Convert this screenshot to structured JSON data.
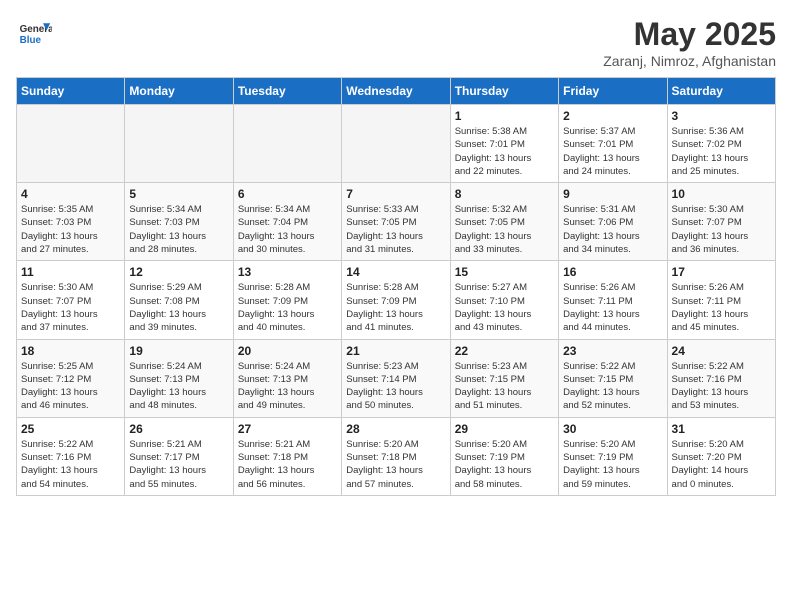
{
  "header": {
    "logo_line1": "General",
    "logo_line2": "Blue",
    "month": "May 2025",
    "location": "Zaranj, Nimroz, Afghanistan"
  },
  "weekdays": [
    "Sunday",
    "Monday",
    "Tuesday",
    "Wednesday",
    "Thursday",
    "Friday",
    "Saturday"
  ],
  "weeks": [
    [
      {
        "day": "",
        "info": ""
      },
      {
        "day": "",
        "info": ""
      },
      {
        "day": "",
        "info": ""
      },
      {
        "day": "",
        "info": ""
      },
      {
        "day": "1",
        "info": "Sunrise: 5:38 AM\nSunset: 7:01 PM\nDaylight: 13 hours\nand 22 minutes."
      },
      {
        "day": "2",
        "info": "Sunrise: 5:37 AM\nSunset: 7:01 PM\nDaylight: 13 hours\nand 24 minutes."
      },
      {
        "day": "3",
        "info": "Sunrise: 5:36 AM\nSunset: 7:02 PM\nDaylight: 13 hours\nand 25 minutes."
      }
    ],
    [
      {
        "day": "4",
        "info": "Sunrise: 5:35 AM\nSunset: 7:03 PM\nDaylight: 13 hours\nand 27 minutes."
      },
      {
        "day": "5",
        "info": "Sunrise: 5:34 AM\nSunset: 7:03 PM\nDaylight: 13 hours\nand 28 minutes."
      },
      {
        "day": "6",
        "info": "Sunrise: 5:34 AM\nSunset: 7:04 PM\nDaylight: 13 hours\nand 30 minutes."
      },
      {
        "day": "7",
        "info": "Sunrise: 5:33 AM\nSunset: 7:05 PM\nDaylight: 13 hours\nand 31 minutes."
      },
      {
        "day": "8",
        "info": "Sunrise: 5:32 AM\nSunset: 7:05 PM\nDaylight: 13 hours\nand 33 minutes."
      },
      {
        "day": "9",
        "info": "Sunrise: 5:31 AM\nSunset: 7:06 PM\nDaylight: 13 hours\nand 34 minutes."
      },
      {
        "day": "10",
        "info": "Sunrise: 5:30 AM\nSunset: 7:07 PM\nDaylight: 13 hours\nand 36 minutes."
      }
    ],
    [
      {
        "day": "11",
        "info": "Sunrise: 5:30 AM\nSunset: 7:07 PM\nDaylight: 13 hours\nand 37 minutes."
      },
      {
        "day": "12",
        "info": "Sunrise: 5:29 AM\nSunset: 7:08 PM\nDaylight: 13 hours\nand 39 minutes."
      },
      {
        "day": "13",
        "info": "Sunrise: 5:28 AM\nSunset: 7:09 PM\nDaylight: 13 hours\nand 40 minutes."
      },
      {
        "day": "14",
        "info": "Sunrise: 5:28 AM\nSunset: 7:09 PM\nDaylight: 13 hours\nand 41 minutes."
      },
      {
        "day": "15",
        "info": "Sunrise: 5:27 AM\nSunset: 7:10 PM\nDaylight: 13 hours\nand 43 minutes."
      },
      {
        "day": "16",
        "info": "Sunrise: 5:26 AM\nSunset: 7:11 PM\nDaylight: 13 hours\nand 44 minutes."
      },
      {
        "day": "17",
        "info": "Sunrise: 5:26 AM\nSunset: 7:11 PM\nDaylight: 13 hours\nand 45 minutes."
      }
    ],
    [
      {
        "day": "18",
        "info": "Sunrise: 5:25 AM\nSunset: 7:12 PM\nDaylight: 13 hours\nand 46 minutes."
      },
      {
        "day": "19",
        "info": "Sunrise: 5:24 AM\nSunset: 7:13 PM\nDaylight: 13 hours\nand 48 minutes."
      },
      {
        "day": "20",
        "info": "Sunrise: 5:24 AM\nSunset: 7:13 PM\nDaylight: 13 hours\nand 49 minutes."
      },
      {
        "day": "21",
        "info": "Sunrise: 5:23 AM\nSunset: 7:14 PM\nDaylight: 13 hours\nand 50 minutes."
      },
      {
        "day": "22",
        "info": "Sunrise: 5:23 AM\nSunset: 7:15 PM\nDaylight: 13 hours\nand 51 minutes."
      },
      {
        "day": "23",
        "info": "Sunrise: 5:22 AM\nSunset: 7:15 PM\nDaylight: 13 hours\nand 52 minutes."
      },
      {
        "day": "24",
        "info": "Sunrise: 5:22 AM\nSunset: 7:16 PM\nDaylight: 13 hours\nand 53 minutes."
      }
    ],
    [
      {
        "day": "25",
        "info": "Sunrise: 5:22 AM\nSunset: 7:16 PM\nDaylight: 13 hours\nand 54 minutes."
      },
      {
        "day": "26",
        "info": "Sunrise: 5:21 AM\nSunset: 7:17 PM\nDaylight: 13 hours\nand 55 minutes."
      },
      {
        "day": "27",
        "info": "Sunrise: 5:21 AM\nSunset: 7:18 PM\nDaylight: 13 hours\nand 56 minutes."
      },
      {
        "day": "28",
        "info": "Sunrise: 5:20 AM\nSunset: 7:18 PM\nDaylight: 13 hours\nand 57 minutes."
      },
      {
        "day": "29",
        "info": "Sunrise: 5:20 AM\nSunset: 7:19 PM\nDaylight: 13 hours\nand 58 minutes."
      },
      {
        "day": "30",
        "info": "Sunrise: 5:20 AM\nSunset: 7:19 PM\nDaylight: 13 hours\nand 59 minutes."
      },
      {
        "day": "31",
        "info": "Sunrise: 5:20 AM\nSunset: 7:20 PM\nDaylight: 14 hours\nand 0 minutes."
      }
    ]
  ]
}
